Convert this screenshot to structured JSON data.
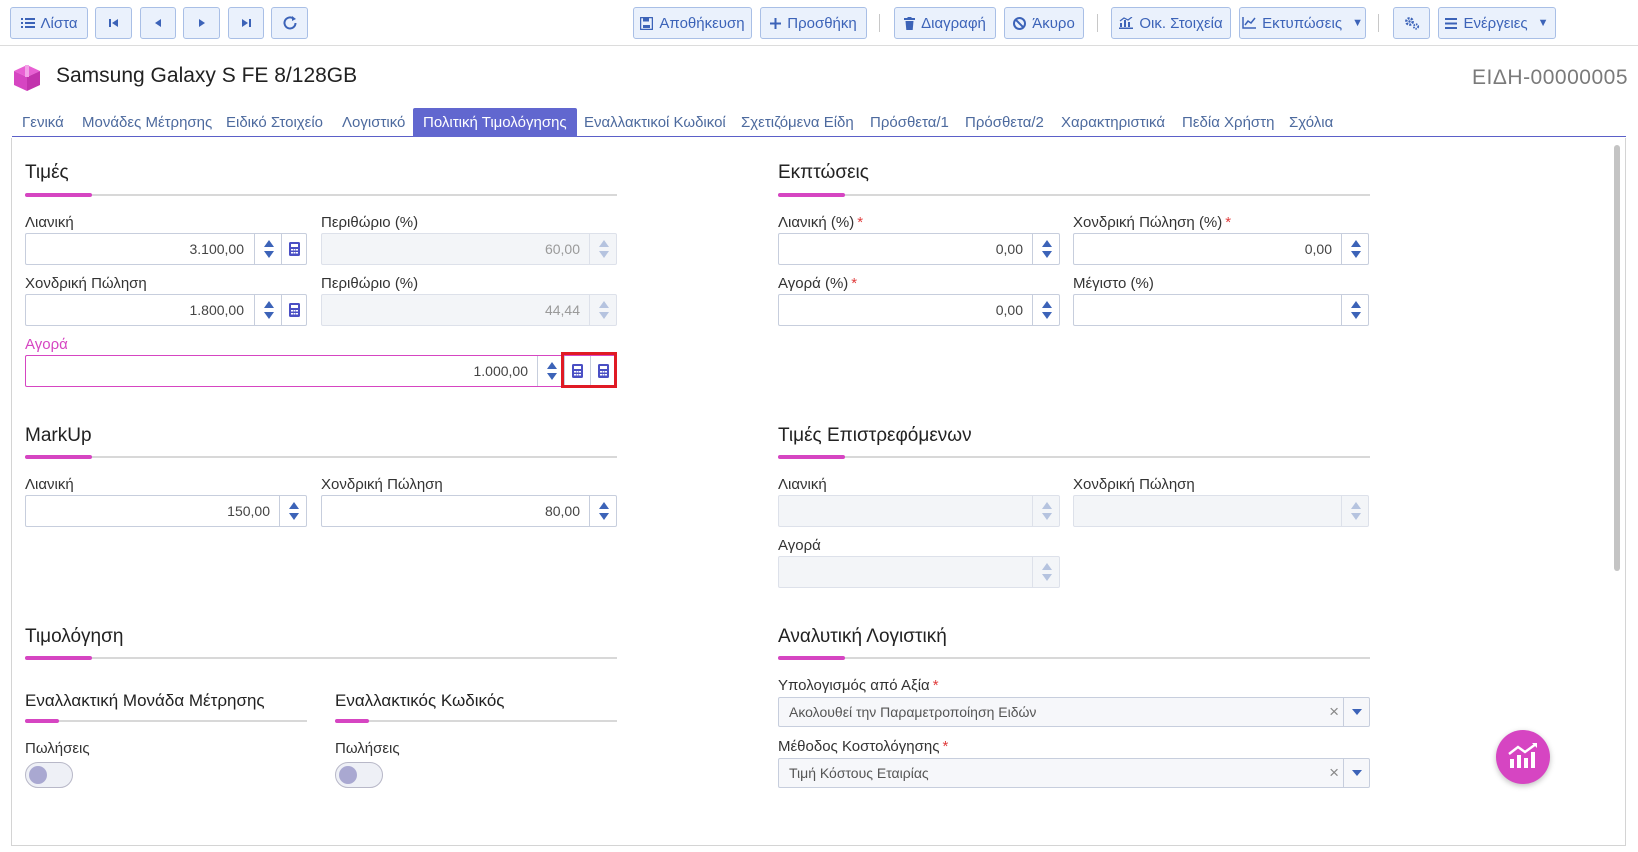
{
  "toolbar": {
    "list_label": "Λίστα",
    "save_label": "Αποθήκευση",
    "add_label": "Προσθήκη",
    "delete_label": "Διαγραφή",
    "cancel_label": "Άκυρο",
    "financial_label": "Οικ. Στοιχεία",
    "print_label": "Εκτυπώσεις",
    "actions_label": "Ενέργειες"
  },
  "header": {
    "title": "Samsung Galaxy S FE 8/128GB",
    "code": "ΕΙΔΗ-00000005"
  },
  "tabs": [
    {
      "label": "Γενικά"
    },
    {
      "label": "Μονάδες Μέτρησης"
    },
    {
      "label": "Ειδικό Στοιχείο"
    },
    {
      "label": "Λογιστικό"
    },
    {
      "label": "Πολιτική Τιμολόγησης"
    },
    {
      "label": "Εναλλακτικοί Κωδικοί"
    },
    {
      "label": "Σχετιζόμενα Είδη"
    },
    {
      "label": "Πρόσθετα/1"
    },
    {
      "label": "Πρόσθετα/2"
    },
    {
      "label": "Χαρακτηριστικά"
    },
    {
      "label": "Πεδία Χρήστη"
    },
    {
      "label": "Σχόλια"
    }
  ],
  "active_tab": "Πολιτική Τιμολόγησης",
  "prices": {
    "title": "Τιμές",
    "retail_label": "Λιανική",
    "retail_value": "3.100,00",
    "retail_margin_label": "Περιθώριο (%)",
    "retail_margin_value": "60,00",
    "wholesale_label": "Χονδρική Πώληση",
    "wholesale_value": "1.800,00",
    "wholesale_margin_label": "Περιθώριο (%)",
    "wholesale_margin_value": "44,44",
    "purchase_label": "Αγορά",
    "purchase_value": "1.000,00"
  },
  "discounts": {
    "title": "Εκπτώσεις",
    "retail_label": "Λιανική (%)",
    "retail_value": "0,00",
    "wholesale_label": "Χονδρική Πώληση (%)",
    "wholesale_value": "0,00",
    "purchase_label": "Αγορά (%)",
    "purchase_value": "0,00",
    "max_label": "Μέγιστο (%)",
    "max_value": "",
    "required_mark": "*"
  },
  "markup": {
    "title": "MarkUp",
    "retail_label": "Λιανική",
    "retail_value": "150,00",
    "wholesale_label": "Χονδρική Πώληση",
    "wholesale_value": "80,00"
  },
  "returns": {
    "title": "Τιμές Επιστρεφόμενων",
    "retail_label": "Λιανική",
    "wholesale_label": "Χονδρική Πώληση",
    "purchase_label": "Αγορά"
  },
  "invoicing": {
    "title": "Τιμολόγηση",
    "alt_unit_title": "Εναλλακτική Μονάδα Μέτρησης",
    "alt_code_title": "Εναλλακτικός Κωδικός",
    "sales_label": "Πωλήσεις",
    "sales_label_2": "Πωλήσεις"
  },
  "analytic": {
    "title": "Αναλυτική Λογιστική",
    "calc_label": "Υπολογισμός από Αξία",
    "calc_value": "Ακολουθεί την Παραμετροποίηση Ειδών",
    "costing_label": "Μέθοδος Κοστολόγησης",
    "costing_value": "Τιμή Κόστους Εταιρίας",
    "clear_glyph": "×",
    "required_mark": "*"
  },
  "colors": {
    "accent": "#d645c2",
    "primary": "#6167cf",
    "button_text": "#3c63b8",
    "highlight": "#e01a24"
  },
  "icons": [
    "list-icon",
    "first-icon",
    "prev-icon",
    "next-icon",
    "last-icon",
    "refresh-icon",
    "save-icon",
    "plus-icon",
    "trash-icon",
    "ban-icon",
    "chart-icon",
    "gears-icon",
    "menu-icon",
    "calculator-icon",
    "box-icon",
    "analytics-icon"
  ]
}
